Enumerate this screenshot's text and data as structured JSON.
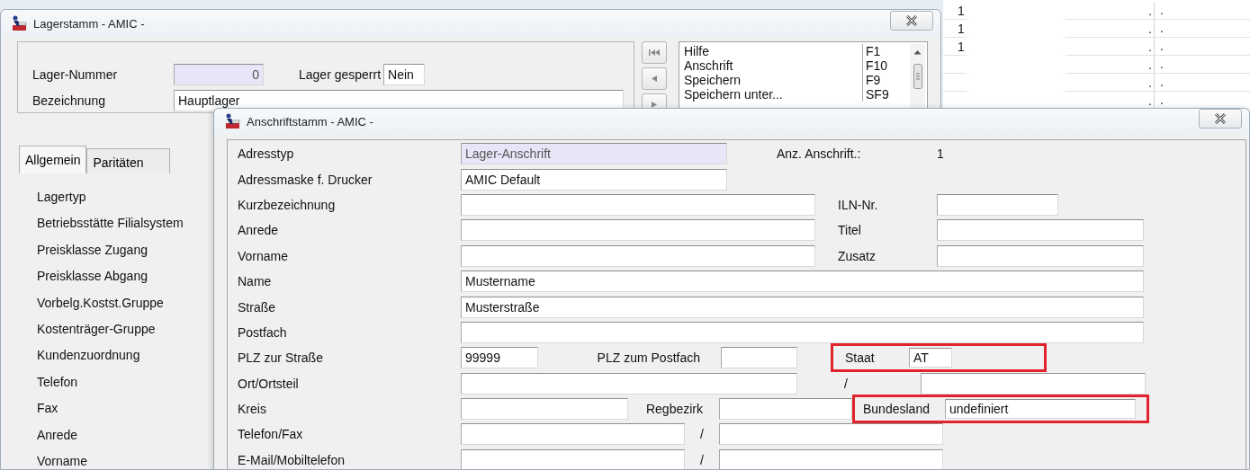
{
  "background_window": {
    "title": "Lagerstamm - AMIC -",
    "fields": [
      {
        "label": "Lager-Nummer",
        "value": "0",
        "readonly": true
      },
      {
        "label": "Lager gesperrt",
        "value": "Nein",
        "readonly": false
      },
      {
        "label": "Bezeichnung",
        "value": "Hauptlager",
        "readonly": false
      }
    ],
    "shortcuts": [
      {
        "label": "Hilfe",
        "key": "F1"
      },
      {
        "label": "Anschrift",
        "key": "F10"
      },
      {
        "label": "Speichern",
        "key": "F9"
      },
      {
        "label": "Speichern unter...",
        "key": "SF9"
      }
    ],
    "tabs": [
      {
        "label": "Allgemein",
        "selected": true
      },
      {
        "label": "Paritäten",
        "selected": false
      }
    ],
    "tab_labels": [
      "Lagertyp",
      "Betriebsstätte Filialsystem",
      "Preisklasse Zugang",
      "Preisklasse Abgang",
      "Vorbelg.Kostst.Gruppe",
      "Kostenträger-Gruppe",
      "Kundenzuordnung",
      "Telefon",
      "Fax",
      "Anrede",
      "Vorname"
    ]
  },
  "background_table": {
    "rows": [
      {
        "column_1": "1",
        "column_2": ".",
        "column_3": "."
      },
      {
        "column_1": "1",
        "column_2": ".",
        "column_3": "."
      },
      {
        "column_1": "1",
        "column_2": ".",
        "column_3": "."
      },
      {
        "column_2": ".",
        "column_3": "."
      },
      {
        "column_2": ".",
        "column_3": "."
      },
      {
        "column_2": ".",
        "column_3": "."
      }
    ]
  },
  "dialog": {
    "title": "Anschriftstamm - AMIC -",
    "rows": [
      {
        "label": "Adresstyp",
        "items": [
          {
            "kind": "field",
            "value": "Lager-Anschrift",
            "readonly": true
          },
          {
            "kind": "label",
            "text": "Anz. Anschrift.:"
          },
          {
            "kind": "label",
            "text": "1"
          }
        ]
      },
      {
        "label": "Adressmaske f. Drucker",
        "items": [
          {
            "kind": "field",
            "value": "AMIC Default",
            "readonly": false
          }
        ]
      },
      {
        "label": "Kurzbezeichnung",
        "items": [
          {
            "kind": "field",
            "readonly": false
          },
          {
            "kind": "label",
            "text": "ILN-Nr."
          },
          {
            "kind": "field",
            "readonly": false
          }
        ]
      },
      {
        "label": "Anrede",
        "items": [
          {
            "kind": "field",
            "readonly": false
          },
          {
            "kind": "label",
            "text": "Titel"
          },
          {
            "kind": "field",
            "readonly": false
          }
        ]
      },
      {
        "label": "Vorname",
        "items": [
          {
            "kind": "field",
            "readonly": false
          },
          {
            "kind": "label",
            "text": "Zusatz"
          },
          {
            "kind": "field",
            "readonly": false
          }
        ]
      },
      {
        "label": "Name",
        "items": [
          {
            "kind": "field",
            "value": "Mustername",
            "readonly": false
          }
        ]
      },
      {
        "label": "Straße",
        "items": [
          {
            "kind": "field",
            "value": "Musterstraße",
            "readonly": false
          }
        ]
      },
      {
        "label": "Postfach",
        "items": [
          {
            "kind": "field",
            "readonly": false
          }
        ]
      },
      {
        "label": "PLZ zur Straße",
        "items": [
          {
            "kind": "field",
            "value": "99999",
            "readonly": false
          },
          {
            "kind": "label",
            "text": "PLZ zum Postfach"
          },
          {
            "kind": "field",
            "readonly": false
          },
          {
            "kind": "group",
            "highlighted": true,
            "items": [
              {
                "kind": "label",
                "text": "Staat"
              },
              {
                "kind": "field",
                "value": "AT",
                "readonly": false
              }
            ]
          }
        ]
      },
      {
        "label": "Ort/Ortsteil",
        "items": [
          {
            "kind": "field",
            "readonly": false
          },
          {
            "kind": "label",
            "text": "/"
          },
          {
            "kind": "field",
            "readonly": false
          }
        ]
      },
      {
        "label": "Kreis",
        "items": [
          {
            "kind": "field",
            "readonly": false
          },
          {
            "kind": "label",
            "text": "Regbezirk"
          },
          {
            "kind": "field",
            "readonly": false
          },
          {
            "kind": "group",
            "highlighted": true,
            "items": [
              {
                "kind": "label",
                "text": "Bundesland"
              },
              {
                "kind": "field",
                "value": "undefiniert",
                "readonly": false
              }
            ]
          }
        ]
      },
      {
        "label": "Telefon/Fax",
        "items": [
          {
            "kind": "field",
            "readonly": false
          },
          {
            "kind": "label",
            "text": "/"
          },
          {
            "kind": "field",
            "readonly": false
          }
        ]
      },
      {
        "label": "E-Mail/Mobiltelefon",
        "items": [
          {
            "kind": "field",
            "readonly": false
          },
          {
            "kind": "label",
            "text": "/"
          },
          {
            "kind": "field",
            "readonly": false
          }
        ]
      }
    ]
  }
}
